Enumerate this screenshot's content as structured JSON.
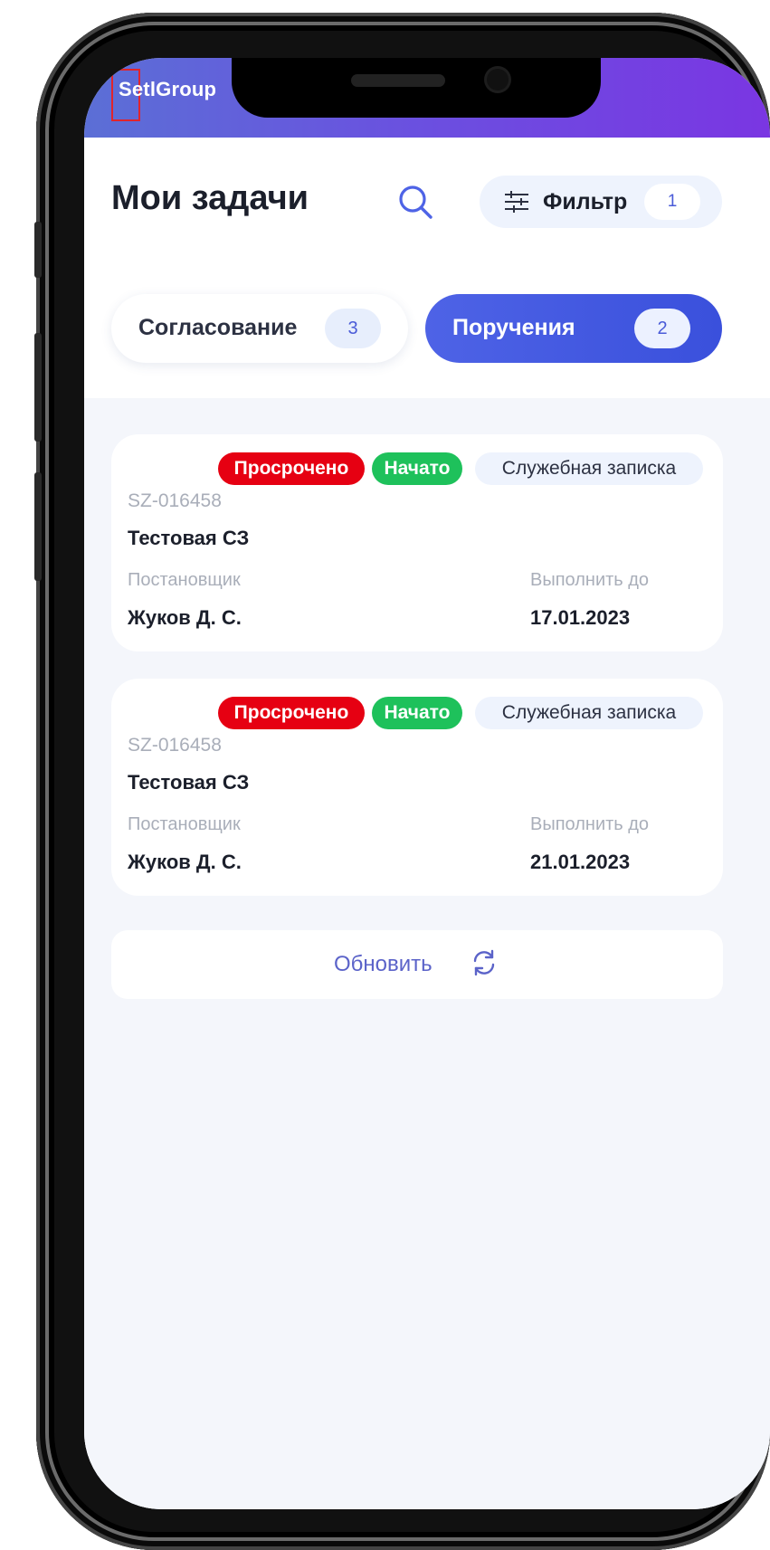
{
  "status_bar": {
    "brand": "SetlGroup"
  },
  "header": {
    "title": "Мои задачи",
    "filter_label": "Фильтр",
    "filter_count": "1"
  },
  "tabs": [
    {
      "label": "Согласование",
      "count": "3",
      "active": false
    },
    {
      "label": "Поручения",
      "count": "2",
      "active": true
    }
  ],
  "tasks": [
    {
      "badges": {
        "overdue": "Просрочено",
        "started": "Начато",
        "type": "Служебная записка"
      },
      "code": "SZ-016458",
      "title": "Тестовая СЗ",
      "assigner_label": "Постановщик",
      "assigner": "Жуков Д. С.",
      "due_label": "Выполнить до",
      "due": "17.01.2023"
    },
    {
      "badges": {
        "overdue": "Просрочено",
        "started": "Начато",
        "type": "Служебная записка"
      },
      "code": "SZ-016458",
      "title": "Тестовая СЗ",
      "assigner_label": "Постановщик",
      "assigner": "Жуков Д. С.",
      "due_label": "Выполнить до",
      "due": "21.01.2023"
    }
  ],
  "refresh": {
    "label": "Обновить"
  },
  "colors": {
    "accent": "#4e63e6",
    "overdue": "#e60012",
    "started": "#1ec15b"
  }
}
